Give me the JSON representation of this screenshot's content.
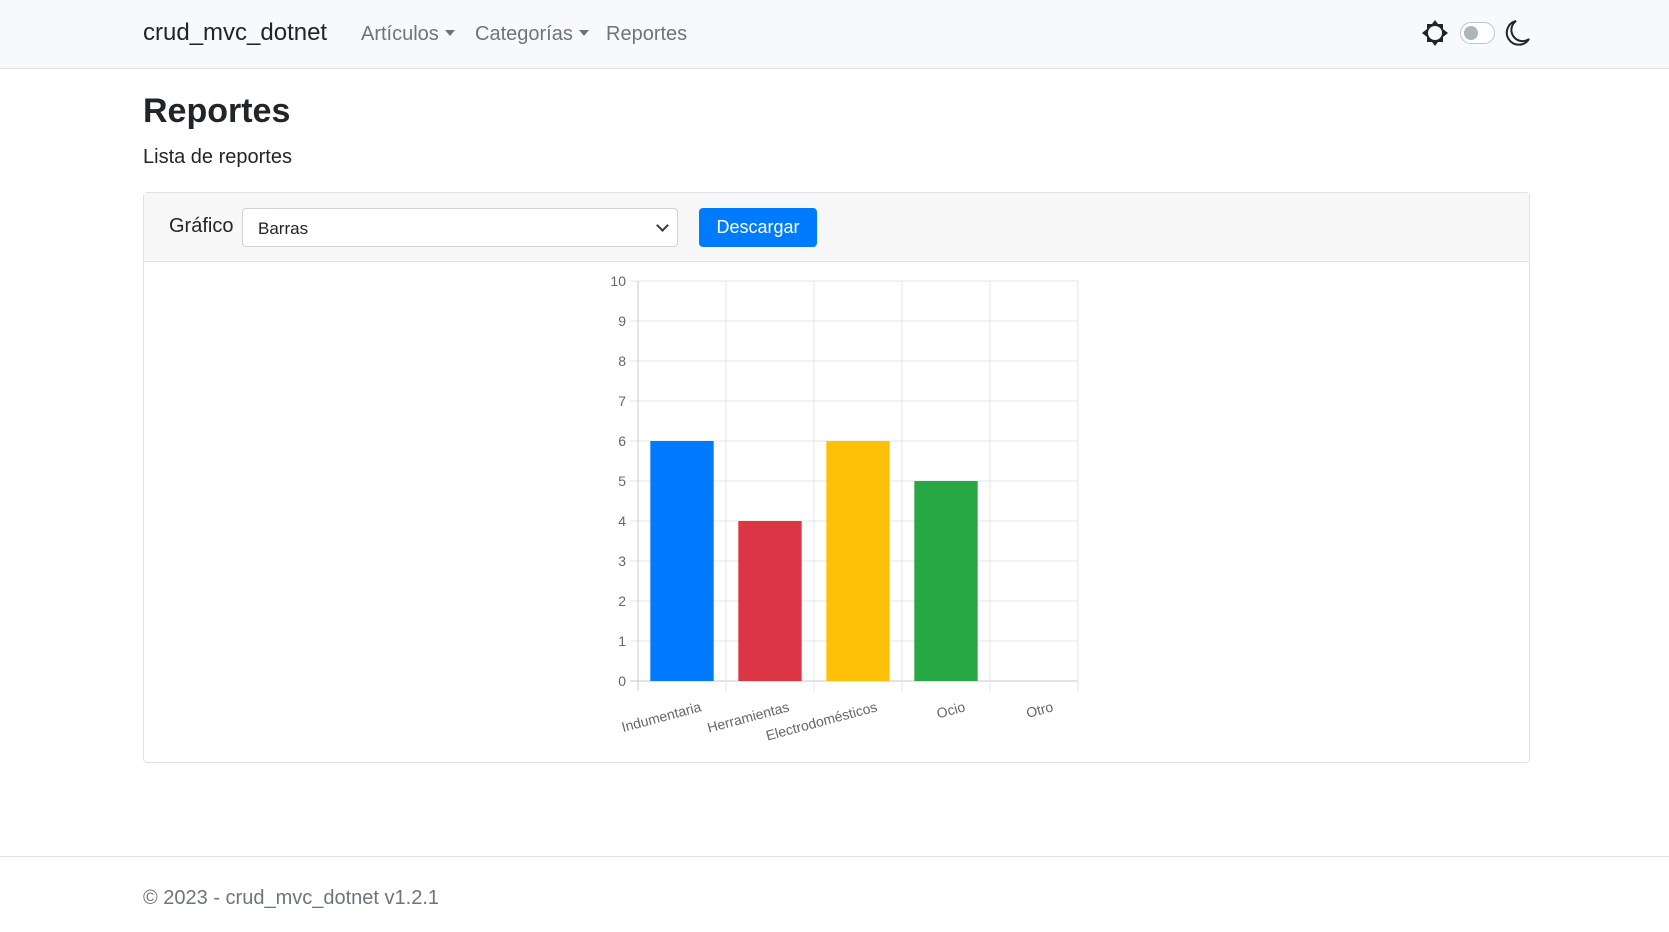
{
  "navbar": {
    "brand": "crud_mvc_dotnet",
    "links": [
      {
        "label": "Artículos",
        "dropdown": true
      },
      {
        "label": "Categorías",
        "dropdown": true
      },
      {
        "label": "Reportes",
        "dropdown": false
      }
    ],
    "theme_icons": [
      "sun-icon",
      "moon-icon"
    ]
  },
  "page": {
    "title": "Reportes",
    "subtitle": "Lista de reportes"
  },
  "toolbar": {
    "chart_label": "Gráfico",
    "chart_type": "Barras",
    "download_label": "Descargar"
  },
  "chart_data": {
    "type": "bar",
    "categories": [
      "Indumentaria",
      "Herramientas",
      "Electrodomésticos",
      "Ocio",
      "Otro"
    ],
    "values": [
      6,
      4,
      6,
      5,
      0
    ],
    "colors": [
      "#007bff",
      "#dc3545",
      "#ffc107",
      "#28a745",
      "#17a2b8"
    ],
    "ylim": [
      0,
      10
    ],
    "yticks": [
      0,
      1,
      2,
      3,
      4,
      5,
      6,
      7,
      8,
      9,
      10
    ],
    "grid": true,
    "title": "",
    "xlabel": "",
    "ylabel": ""
  },
  "footer": {
    "text": "© 2023 - crud_mvc_dotnet v1.2.1"
  }
}
